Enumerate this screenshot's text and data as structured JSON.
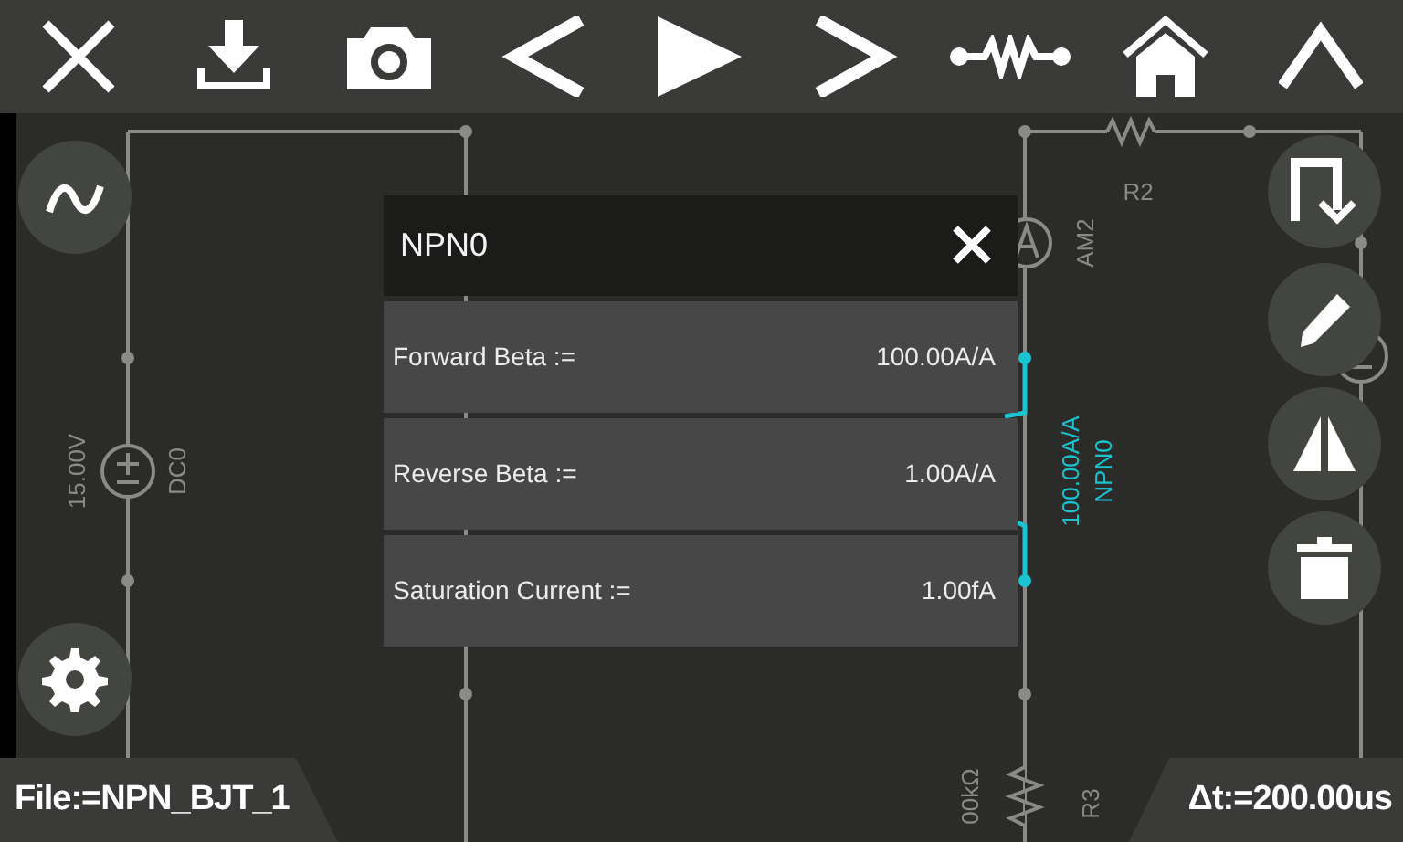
{
  "circuit": {
    "labels": [
      {
        "text": "15.00V",
        "color": "#8a8a88"
      },
      {
        "text": "DC0",
        "color": "#8a8a88"
      },
      {
        "text": "R2",
        "color": "#8a8a88"
      },
      {
        "text": "AM2",
        "color": "#8a8a88"
      },
      {
        "text": "100.00A/A",
        "color": "#19c4d0"
      },
      {
        "text": "NPN0",
        "color": "#19c4d0"
      },
      {
        "text": "00kΩ",
        "color": "#8a8a88"
      },
      {
        "text": "R3",
        "color": "#8a8a88"
      }
    ]
  },
  "dialog": {
    "title": "NPN0",
    "params": [
      {
        "label": "Forward Beta :=",
        "value": "100.00A/A"
      },
      {
        "label": "Reverse Beta :=",
        "value": "1.00A/A"
      },
      {
        "label": "Saturation Current :=",
        "value": "1.00fA"
      }
    ]
  },
  "status": {
    "file": "File:=NPN_BJT_1",
    "timestep": "Δt:=200.00us"
  }
}
